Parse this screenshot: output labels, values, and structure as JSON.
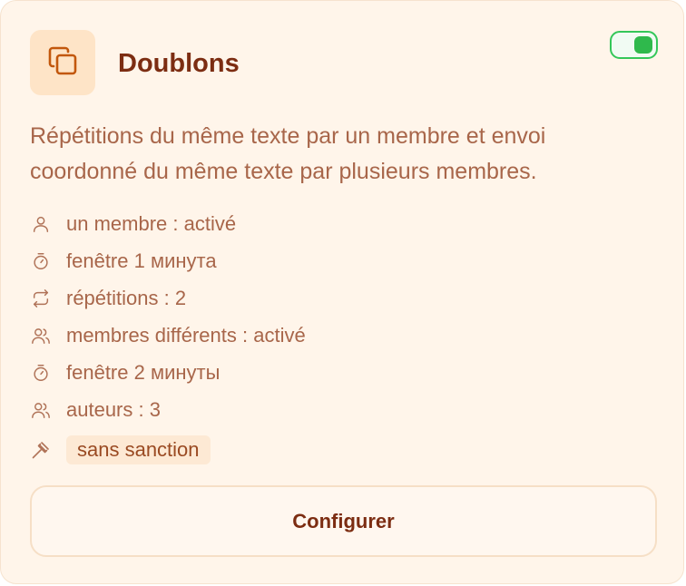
{
  "card": {
    "title": "Doublons",
    "icon": "copy-icon",
    "enabled": true,
    "accent_color": "#7c2d12",
    "toggle_color": "#34c759",
    "description": "Répétitions du même texte par un membre et envoi coordonné du même texte par plusieurs membres.",
    "features": [
      {
        "icon": "user-icon",
        "text": "un membre : activé"
      },
      {
        "icon": "timer-icon",
        "text": "fenêtre 1 минута"
      },
      {
        "icon": "repeat-icon",
        "text": "répétitions : 2"
      },
      {
        "icon": "users-icon",
        "text": "membres différents : activé"
      },
      {
        "icon": "timer-icon",
        "text": "fenêtre 2 минуты"
      },
      {
        "icon": "users-icon",
        "text": "auteurs : 3"
      },
      {
        "icon": "gavel-icon",
        "text": "sans sanction"
      }
    ],
    "configure_label": "Configurer"
  }
}
